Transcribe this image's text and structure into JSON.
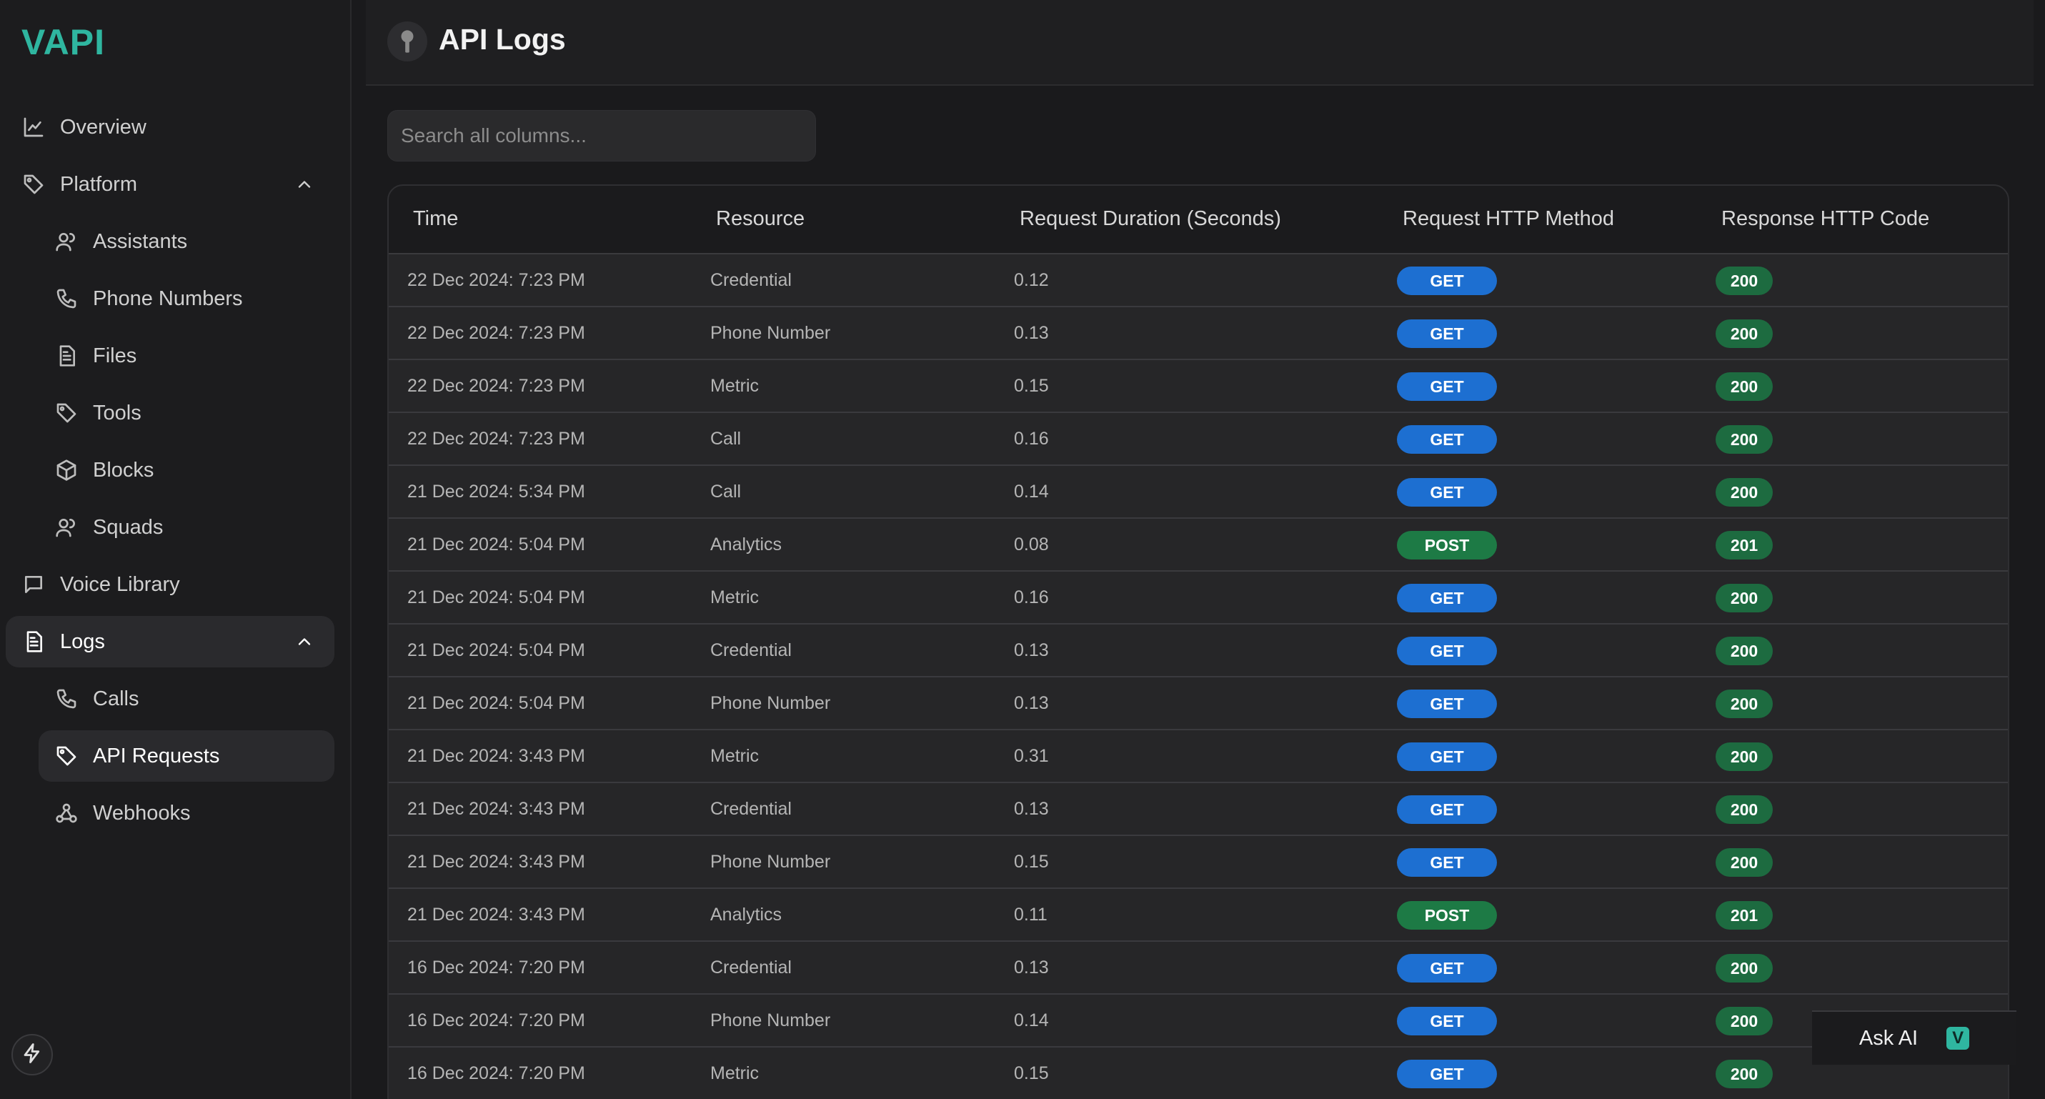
{
  "app": {
    "logo": "VAPI"
  },
  "sidebar": {
    "overview": {
      "label": "Overview",
      "icon": "chart-line-icon"
    },
    "platform": {
      "label": "Platform",
      "icon": "tag-icon",
      "items": [
        {
          "label": "Assistants",
          "icon": "users-icon"
        },
        {
          "label": "Phone Numbers",
          "icon": "phone-icon"
        },
        {
          "label": "Files",
          "icon": "file-icon"
        },
        {
          "label": "Tools",
          "icon": "tag-icon"
        },
        {
          "label": "Blocks",
          "icon": "cube-icon"
        },
        {
          "label": "Squads",
          "icon": "users-icon"
        }
      ]
    },
    "voice_library": {
      "label": "Voice Library",
      "icon": "chat-icon"
    },
    "logs": {
      "label": "Logs",
      "icon": "file-icon",
      "items": [
        {
          "label": "Calls",
          "icon": "phone-icon"
        },
        {
          "label": "API Requests",
          "icon": "tag-icon"
        },
        {
          "label": "Webhooks",
          "icon": "webhook-icon"
        }
      ]
    }
  },
  "header": {
    "title": "API Logs",
    "icon": "key-icon"
  },
  "search": {
    "placeholder": "Search all columns..."
  },
  "table": {
    "columns": [
      "Time",
      "Resource",
      "Request Duration (Seconds)",
      "Request HTTP Method",
      "Response HTTP Code"
    ],
    "rows": [
      {
        "time": "22 Dec 2024: 7:23 PM",
        "resource": "Credential",
        "duration": "0.12",
        "method": "GET",
        "code": "200"
      },
      {
        "time": "22 Dec 2024: 7:23 PM",
        "resource": "Phone Number",
        "duration": "0.13",
        "method": "GET",
        "code": "200"
      },
      {
        "time": "22 Dec 2024: 7:23 PM",
        "resource": "Metric",
        "duration": "0.15",
        "method": "GET",
        "code": "200"
      },
      {
        "time": "22 Dec 2024: 7:23 PM",
        "resource": "Call",
        "duration": "0.16",
        "method": "GET",
        "code": "200"
      },
      {
        "time": "21 Dec 2024: 5:34 PM",
        "resource": "Call",
        "duration": "0.14",
        "method": "GET",
        "code": "200"
      },
      {
        "time": "21 Dec 2024: 5:04 PM",
        "resource": "Analytics",
        "duration": "0.08",
        "method": "POST",
        "code": "201"
      },
      {
        "time": "21 Dec 2024: 5:04 PM",
        "resource": "Metric",
        "duration": "0.16",
        "method": "GET",
        "code": "200"
      },
      {
        "time": "21 Dec 2024: 5:04 PM",
        "resource": "Credential",
        "duration": "0.13",
        "method": "GET",
        "code": "200"
      },
      {
        "time": "21 Dec 2024: 5:04 PM",
        "resource": "Phone Number",
        "duration": "0.13",
        "method": "GET",
        "code": "200"
      },
      {
        "time": "21 Dec 2024: 3:43 PM",
        "resource": "Metric",
        "duration": "0.31",
        "method": "GET",
        "code": "200"
      },
      {
        "time": "21 Dec 2024: 3:43 PM",
        "resource": "Credential",
        "duration": "0.13",
        "method": "GET",
        "code": "200"
      },
      {
        "time": "21 Dec 2024: 3:43 PM",
        "resource": "Phone Number",
        "duration": "0.15",
        "method": "GET",
        "code": "200"
      },
      {
        "time": "21 Dec 2024: 3:43 PM",
        "resource": "Analytics",
        "duration": "0.11",
        "method": "POST",
        "code": "201"
      },
      {
        "time": "16 Dec 2024: 7:20 PM",
        "resource": "Credential",
        "duration": "0.13",
        "method": "GET",
        "code": "200"
      },
      {
        "time": "16 Dec 2024: 7:20 PM",
        "resource": "Phone Number",
        "duration": "0.14",
        "method": "GET",
        "code": "200"
      },
      {
        "time": "16 Dec 2024: 7:20 PM",
        "resource": "Metric",
        "duration": "0.15",
        "method": "GET",
        "code": "200"
      }
    ]
  },
  "ask_ai": {
    "label": "Ask AI",
    "badge": "V"
  },
  "colors": {
    "accent": "#2fb6a0",
    "get": "#1d6fd1",
    "post": "#1d7a45",
    "status_ok": "#1d6b40"
  }
}
